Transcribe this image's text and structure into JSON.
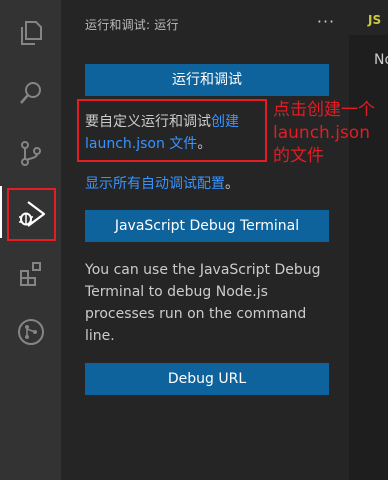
{
  "sidebar": {
    "header": "运行和调试: 运行",
    "more_label": "···",
    "run_debug_button": "运行和调试",
    "custom_text": "要自定义运行和调试",
    "custom_link": "创建 launch.json 文件",
    "custom_end": "。",
    "show_all_link": "显示所有自动调试配置",
    "show_all_end": "。",
    "js_terminal_button": "JavaScript Debug Terminal",
    "description": "You can use the JavaScript Debug Terminal to debug Node.js processes run on the command line.",
    "debug_url_button": "Debug URL"
  },
  "editor": {
    "tab_label": "JS",
    "partial_text": "No"
  },
  "annotation": {
    "lines": [
      "点击创建一个",
      "launch.json",
      "的文件"
    ]
  },
  "activity_bar": {
    "icons": [
      "explorer-icon",
      "search-icon",
      "source-control-icon",
      "run-debug-icon",
      "extensions-icon",
      "remote-icon"
    ]
  },
  "colors": {
    "accent_button": "#0e639c",
    "link": "#3794ff",
    "annotation_red": "#e51c23",
    "sidebar_bg": "#252526",
    "activity_bg": "#333333"
  }
}
